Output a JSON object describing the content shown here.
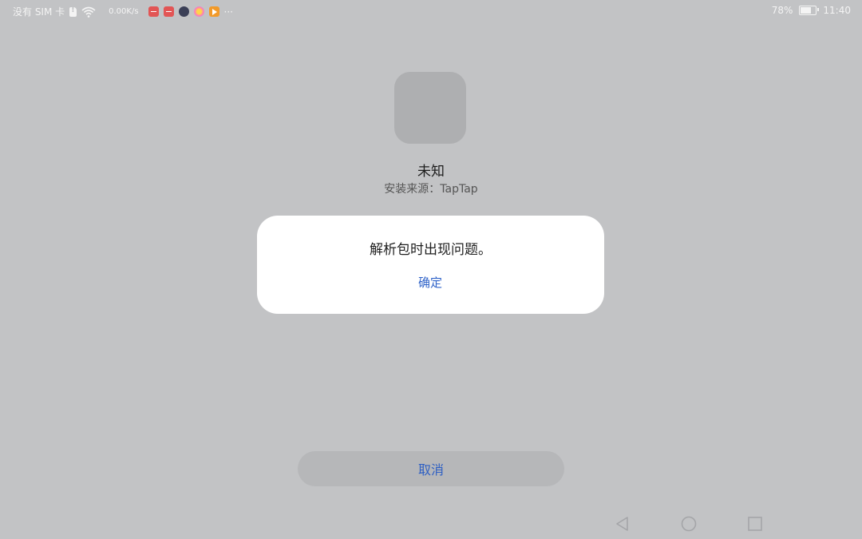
{
  "status_bar": {
    "carrier": "没有 SIM 卡",
    "network_speed": "0.00K/s",
    "notification_icons": [
      "red-app-icon",
      "red-app-icon",
      "avatar-app-icon",
      "flower-app-icon",
      "play-app-icon"
    ],
    "overflow": "···",
    "battery_percent": "78%",
    "battery_level": 0.78,
    "time": "11:40"
  },
  "app_info": {
    "name": "未知",
    "install_source": "安装来源：TapTap"
  },
  "dialog": {
    "message": "解析包时出现问题。",
    "confirm_label": "确定"
  },
  "footer": {
    "cancel_label": "取消"
  },
  "nav_bar": {
    "icons": [
      "back-icon",
      "home-icon",
      "recents-icon"
    ]
  },
  "colors": {
    "background": "#c2c3c5",
    "accent": "#2f63c9",
    "dialog": "#ffffff"
  }
}
